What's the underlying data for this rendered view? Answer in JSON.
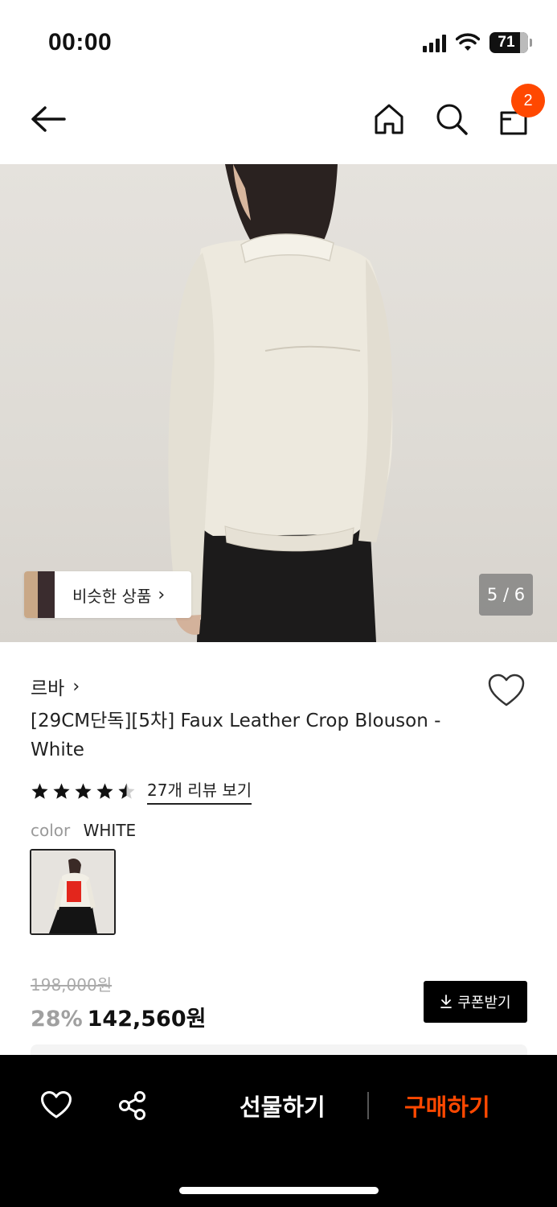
{
  "status": {
    "time": "00:00",
    "battery": "71"
  },
  "nav": {
    "cart_count": "2",
    "icons": [
      "back-arrow-icon",
      "home-icon",
      "search-icon",
      "cart-icon"
    ]
  },
  "gallery": {
    "similar_label": "비슷한 상품",
    "page_indicator": "5 / 6"
  },
  "product": {
    "brand": "르바",
    "title": "[29CM단독][5차] Faux Leather Crop Blouson - White",
    "rating": 4.5,
    "review_link": "27개 리뷰 보기",
    "color_label": "color",
    "color_value": "WHITE",
    "original_price": "198,000원",
    "discount": "28%",
    "price": "142,560원",
    "coupon_label": "쿠폰받기"
  },
  "bottom_bar": {
    "gift_label": "선물하기",
    "buy_label": "구매하기"
  },
  "colors": {
    "accent": "#ff4800",
    "bar": "#000000"
  }
}
